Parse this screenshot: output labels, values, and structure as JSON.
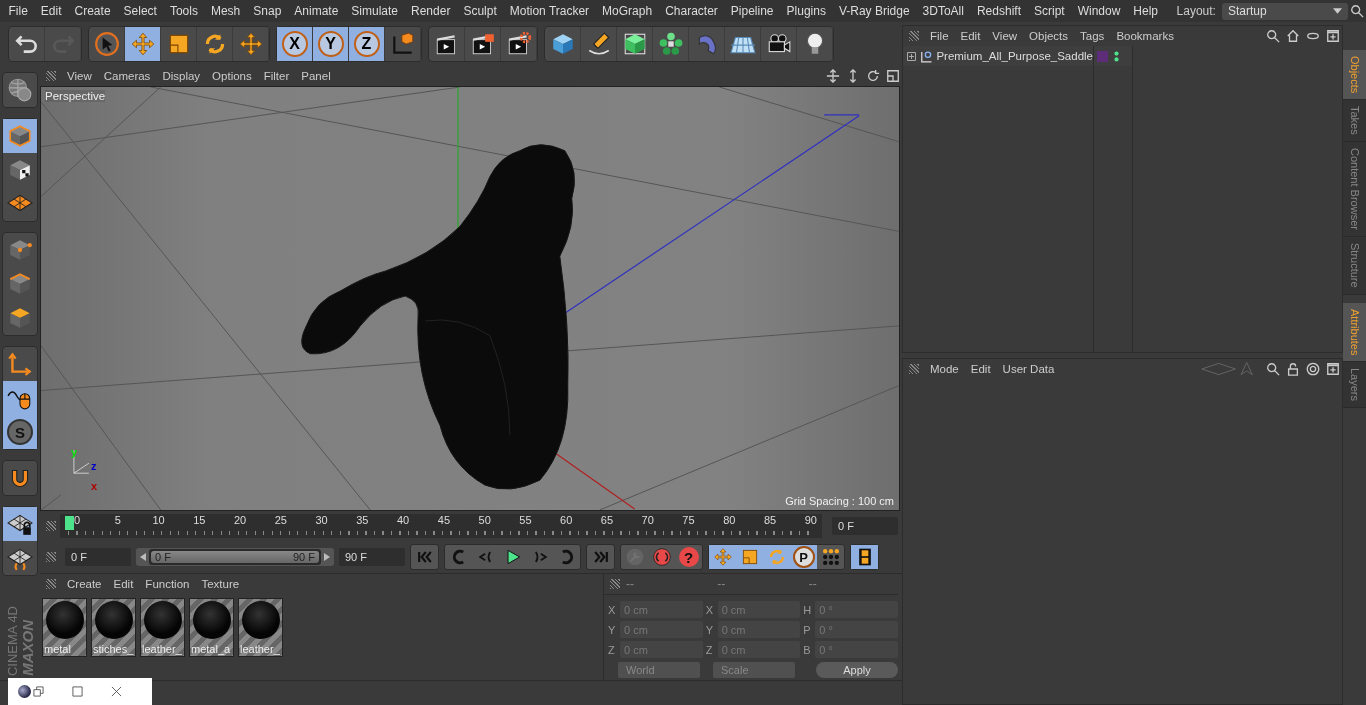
{
  "menu_bar": [
    "File",
    "Edit",
    "Create",
    "Select",
    "Tools",
    "Mesh",
    "Snap",
    "Animate",
    "Simulate",
    "Render",
    "Sculpt",
    "Motion Tracker",
    "MoGraph",
    "Character",
    "Pipeline",
    "Plugins",
    "V-Ray Bridge",
    "3DToAll",
    "Redshift",
    "Script",
    "Window",
    "Help"
  ],
  "layout": {
    "label": "Layout:",
    "value": "Startup"
  },
  "toolbar": [
    [
      {
        "selected": false,
        "disabled": false
      },
      {
        "selected": false,
        "disabled": true
      }
    ],
    [
      {
        "selected": false,
        "disabled": false
      },
      {
        "selected": true,
        "disabled": false
      },
      {
        "selected": false,
        "disabled": false
      },
      {
        "selected": false,
        "disabled": false
      },
      {
        "selected": false,
        "disabled": false
      }
    ],
    [
      {
        "label": "X",
        "selected": true,
        "disabled": false
      },
      {
        "label": "Y",
        "selected": true,
        "disabled": false
      },
      {
        "label": "Z",
        "selected": true,
        "disabled": false
      },
      {
        "selected": false,
        "disabled": false
      }
    ],
    [
      {
        "selected": false,
        "disabled": false
      },
      {
        "selected": false,
        "disabled": false
      },
      {
        "selected": false,
        "disabled": false
      }
    ],
    [
      {
        "selected": false,
        "disabled": false
      },
      {
        "selected": false,
        "disabled": false
      },
      {
        "selected": false,
        "disabled": false
      },
      {
        "selected": false,
        "disabled": false
      },
      {
        "selected": false,
        "disabled": false
      },
      {
        "selected": false,
        "disabled": false
      },
      {
        "selected": false,
        "disabled": false
      },
      {
        "selected": false,
        "disabled": false
      }
    ]
  ],
  "left_toolbar": [
    [
      {
        "selected": false
      }
    ],
    [
      {
        "selected": true
      },
      {
        "selected": false
      },
      {
        "selected": false
      }
    ],
    [
      {
        "selected": false
      },
      {
        "selected": false
      },
      {
        "selected": false
      }
    ],
    [
      {
        "selected": false
      },
      {
        "selected": true
      },
      {
        "label": "S",
        "selected": true
      }
    ],
    [
      {
        "selected": false
      }
    ],
    [
      {
        "selected": true
      },
      {
        "selected": false
      }
    ]
  ],
  "logo": {
    "brand": "MAXON",
    "product": "CINEMA 4D"
  },
  "viewport": {
    "menu": [
      "View",
      "Cameras",
      "Display",
      "Options",
      "Filter",
      "Panel"
    ],
    "camera": "Perspective",
    "grid_spacing": "Grid Spacing : 100 cm",
    "gizmo_labels": [
      "y",
      "z",
      "x"
    ]
  },
  "timeline": {
    "ticks": [
      "0",
      "5",
      "10",
      "15",
      "20",
      "25",
      "30",
      "35",
      "40",
      "45",
      "50",
      "55",
      "60",
      "65",
      "70",
      "75",
      "80",
      "85",
      "90"
    ],
    "level": 0,
    "current_frame": "0 F"
  },
  "transport": {
    "start": "0 F",
    "range": {
      "start": "0 F",
      "end": "90 F",
      "level": 1
    },
    "end": "90 F",
    "record": [
      {
        "disabled": true
      },
      {
        "disabled": false
      },
      {
        "label": "?",
        "disabled": false
      }
    ],
    "key_modes": [
      {
        "selected": true
      },
      {
        "selected": true
      },
      {
        "selected": true
      },
      {
        "label": "P",
        "selected": true
      },
      {
        "selected": false
      }
    ],
    "timeline_selected": true
  },
  "materials": {
    "menu": [
      "Create",
      "Edit",
      "Function",
      "Texture"
    ],
    "items": [
      {
        "name": "metal"
      },
      {
        "name": "stiches_"
      },
      {
        "name": "leather_"
      },
      {
        "name": "metal_a"
      },
      {
        "name": "leather_"
      }
    ]
  },
  "coordinates": {
    "headers": [
      "--",
      "--",
      "--"
    ],
    "rows": [
      {
        "labels": [
          "X",
          "X",
          "H"
        ],
        "values": [
          "0 cm",
          "0 cm",
          "0 °"
        ]
      },
      {
        "labels": [
          "Y",
          "Y",
          "P"
        ],
        "values": [
          "0 cm",
          "0 cm",
          "0 °"
        ]
      },
      {
        "labels": [
          "Z",
          "Z",
          "B"
        ],
        "values": [
          "0 cm",
          "0 cm",
          "0 °"
        ]
      }
    ],
    "space": "World",
    "mode": "Scale",
    "apply": "Apply"
  },
  "objects": {
    "menu": [
      "File",
      "Edit",
      "View",
      "Objects",
      "Tags",
      "Bookmarks"
    ],
    "items": [
      {
        "name": "Premium_All_Purpose_Saddle",
        "expanded": false,
        "color": "#5e2d79"
      }
    ]
  },
  "attributes": {
    "menu": [
      "Mode",
      "Edit",
      "User Data"
    ]
  },
  "side_tabs_top": [
    {
      "label": "Objects",
      "selected": true
    },
    {
      "label": "Takes",
      "selected": false
    },
    {
      "label": "Content Browser",
      "selected": false
    },
    {
      "label": "Structure",
      "selected": false
    }
  ],
  "side_tabs_bottom": [
    {
      "label": "Attributes",
      "selected": true
    },
    {
      "label": "Layers",
      "selected": false
    }
  ]
}
